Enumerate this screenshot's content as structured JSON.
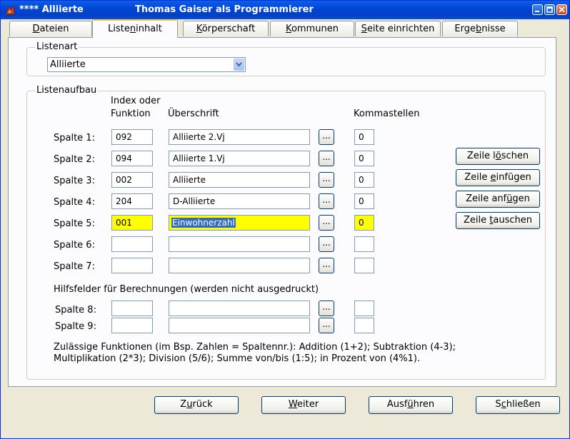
{
  "window": {
    "title_app": "**** Alliierte",
    "title_user": "Thomas Gaiser als Programmierer"
  },
  "tabs": [
    {
      "label": "Dateien",
      "access_key": "D",
      "active": false
    },
    {
      "label": "Listeninhalt",
      "access_key": "n",
      "active": true
    },
    {
      "label": "Körperschaft",
      "access_key": "K",
      "active": false
    },
    {
      "label": "Kommunen",
      "access_key": "K",
      "active": false
    },
    {
      "label": "Seite einrichten",
      "access_key": "S",
      "active": false
    },
    {
      "label": "Ergebnisse",
      "access_key": "b",
      "active": false
    }
  ],
  "listenart": {
    "legend": "Listenart",
    "selected": "Alliierte"
  },
  "listenaufbau": {
    "legend": "Listenaufbau",
    "header_index_1": "Index oder",
    "header_index_2": "Funktion",
    "header_title": "Überschrift",
    "header_decimals": "Kommastellen",
    "hilfs_label": "Hilfsfelder für Berechnungen (werden nicht ausgedruckt)",
    "dots_label": "...",
    "rows": [
      {
        "label": "Spalte 1:",
        "index": "092",
        "title": "Alliierte 2.Vj",
        "decimals": "0"
      },
      {
        "label": "Spalte 2:",
        "index": "094",
        "title": "Alliierte 1.Vj",
        "decimals": "0"
      },
      {
        "label": "Spalte 3:",
        "index": "002",
        "title": "Alliierte",
        "decimals": "0"
      },
      {
        "label": "Spalte 4:",
        "index": "204",
        "title": "D-Alliierte",
        "decimals": "0"
      },
      {
        "label": "Spalte 5:",
        "index": "001",
        "title": "Einwohnerzahl",
        "decimals": "0",
        "highlighted": true
      },
      {
        "label": "Spalte 6:",
        "index": "",
        "title": "",
        "decimals": ""
      },
      {
        "label": "Spalte 7:",
        "index": "",
        "title": "",
        "decimals": ""
      },
      {
        "label": "Spalte 8:",
        "index": "",
        "title": "",
        "decimals": ""
      },
      {
        "label": "Spalte 9:",
        "index": "",
        "title": "",
        "decimals": ""
      }
    ],
    "info_line1": "Zulässige Funktionen (im Bsp. Zahlen = Spaltennr.): Addition (1+2); Subtraktion (4-3);",
    "info_line2": "Multiplikation (2*3); Division (5/6); Summe von/bis (1:5); in Prozent von (4%1)."
  },
  "row_buttons": {
    "delete": {
      "pre": "Zeile l",
      "key": "ö",
      "post": "schen"
    },
    "insert": {
      "pre": "Zeile ",
      "key": "e",
      "post": "infügen"
    },
    "append": {
      "pre": "Zeile anf",
      "key": "ü",
      "post": "gen"
    },
    "swap": {
      "pre": "Zeile ",
      "key": "t",
      "post": "auschen"
    }
  },
  "footer": {
    "back": {
      "pre": "Z",
      "key": "u",
      "post": "rück"
    },
    "next": {
      "pre": "",
      "key": "W",
      "post": "eiter"
    },
    "run": {
      "pre": "Ausf",
      "key": "ü",
      "post": "hren"
    },
    "close": {
      "pre": "S",
      "key": "c",
      "post": "hließen"
    }
  },
  "colors": {
    "highlight": "#FFFF00",
    "selection": "#316AC5",
    "titlebar": "#0A5FE8"
  }
}
